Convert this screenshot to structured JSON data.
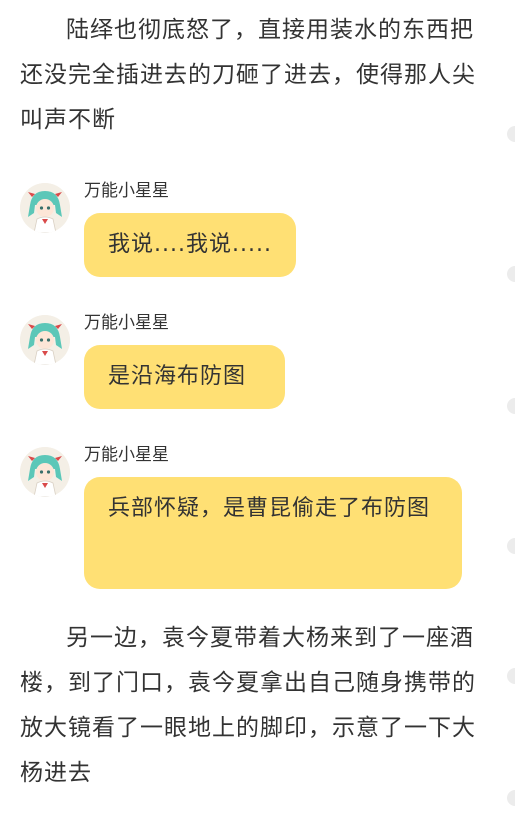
{
  "story": {
    "paragraph_1": "陆绎也彻底怒了，直接用装水的东西把还没完全插进去的刀砸了进去，使得那人尖叫声不断",
    "paragraph_2": "另一边，袁今夏带着大杨来到了一座酒楼，到了门口，袁今夏拿出自己随身携带的放大镜看了一眼地上的脚印，示意了一下大杨进去"
  },
  "messages": [
    {
      "sender": "万能小星星",
      "text": "我说....我说....."
    },
    {
      "sender": "万能小星星",
      "text": "是沿海布防图"
    },
    {
      "sender": "万能小星星",
      "text": "兵部怀疑，是曹昆偷走了布防图"
    }
  ],
  "colors": {
    "bubble": "#ffe074",
    "text": "#333333",
    "background": "#ffffff"
  },
  "icons": {
    "avatar": "anime-girl-avatar-icon"
  }
}
